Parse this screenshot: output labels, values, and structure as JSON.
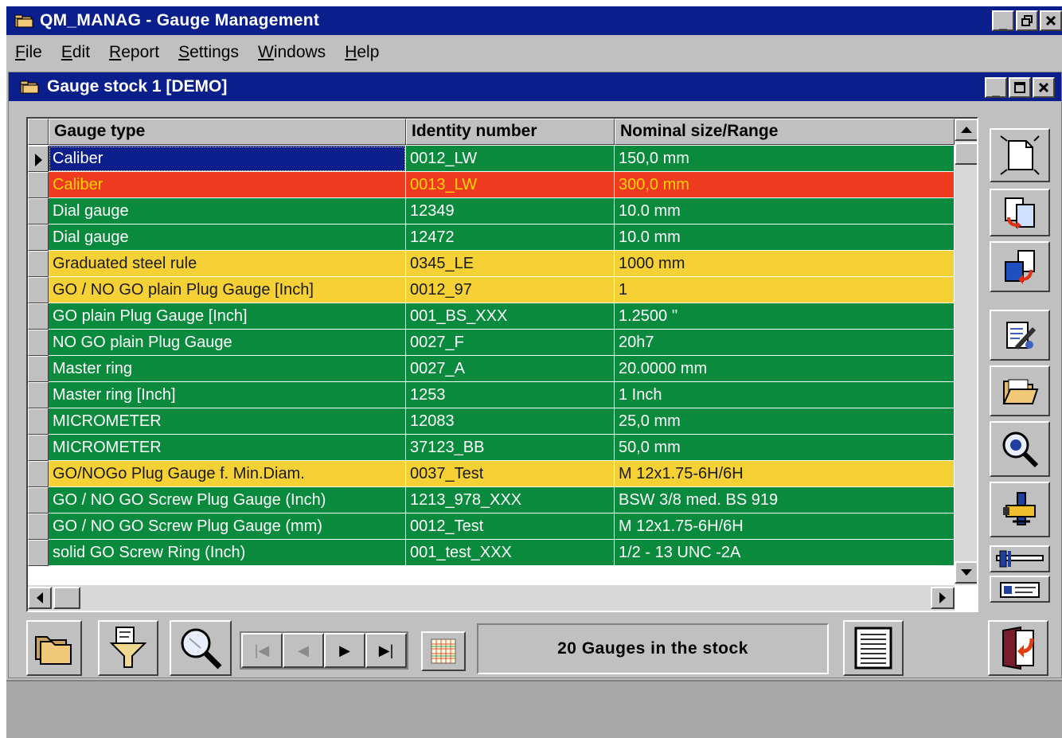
{
  "app": {
    "title": "QM_MANAG - Gauge Management"
  },
  "menu": [
    {
      "label": "File",
      "key": "F",
      "rest": "ile"
    },
    {
      "label": "Edit",
      "key": "E",
      "rest": "dit"
    },
    {
      "label": "Report",
      "key": "R",
      "rest": "eport"
    },
    {
      "label": "Settings",
      "key": "S",
      "rest": "ettings"
    },
    {
      "label": "Windows",
      "key": "W",
      "rest": "indows"
    },
    {
      "label": "Help",
      "key": "H",
      "rest": "elp"
    }
  ],
  "window_buttons": {
    "minimize": "_",
    "restore": "🗗",
    "close": "✕"
  },
  "child_window": {
    "title": "Gauge stock 1 [DEMO]"
  },
  "table": {
    "columns": [
      "Gauge type",
      "Identity number",
      "Nominal size/Range"
    ],
    "rows": [
      {
        "type": "Caliber",
        "id": "0012_LW",
        "size": "150,0 mm",
        "status": "green",
        "selected": true
      },
      {
        "type": "Caliber",
        "id": "0013_LW",
        "size": "300,0 mm",
        "status": "red"
      },
      {
        "type": "Dial gauge",
        "id": "12349",
        "size": "10.0 mm",
        "status": "green"
      },
      {
        "type": "Dial gauge",
        "id": "12472",
        "size": "10.0 mm",
        "status": "green"
      },
      {
        "type": "Graduated steel rule",
        "id": "0345_LE",
        "size": "1000 mm",
        "status": "yellow"
      },
      {
        "type": "GO / NO GO plain Plug Gauge [Inch]",
        "id": "0012_97",
        "size": "1",
        "status": "yellow"
      },
      {
        "type": "GO plain Plug Gauge [Inch]",
        "id": "001_BS_XXX",
        "size": "1.2500 ''",
        "status": "green"
      },
      {
        "type": "NO GO plain Plug Gauge",
        "id": "0027_F",
        "size": "20h7",
        "status": "green"
      },
      {
        "type": "Master ring",
        "id": "0027_A",
        "size": "20.0000 mm",
        "status": "green"
      },
      {
        "type": "Master ring [Inch]",
        "id": "1253",
        "size": "1 Inch",
        "status": "green"
      },
      {
        "type": "MICROMETER",
        "id": "12083",
        "size": "25,0 mm",
        "status": "green"
      },
      {
        "type": "MICROMETER",
        "id": "37123_BB",
        "size": "50,0 mm",
        "status": "green"
      },
      {
        "type": "GO/NOGo Plug Gauge f. Min.Diam.",
        "id": "0037_Test",
        "size": "M 12x1.75-6H/6H",
        "status": "yellow"
      },
      {
        "type": "GO / NO GO Screw Plug Gauge (Inch)",
        "id": "1213_978_XXX",
        "size": " BSW 3/8 med. BS 919",
        "status": "green"
      },
      {
        "type": "GO / NO GO Screw Plug Gauge (mm)",
        "id": "0012_Test",
        "size": "M 12x1.75-6H/6H",
        "status": "green"
      },
      {
        "type": "solid GO Screw Ring (Inch)",
        "id": "001_test_XXX",
        "size": "1/2 - 13 UNC -2A",
        "status": "green"
      }
    ]
  },
  "status": {
    "text": "20  Gauges in the stock"
  },
  "colors": {
    "green": "#098a3c",
    "red": "#ee3a1e",
    "yellow": "#f6d135",
    "titlebar": "#0a1e8c"
  },
  "side_toolbar": [
    "new-document-icon",
    "copy-record-icon",
    "import-record-icon",
    "edit-record-icon",
    "open-folder-icon",
    "search-gauge-icon",
    "calibration-tool-icon",
    "caliper-icon",
    "measure-card-icon"
  ],
  "bottom_toolbar": [
    "stock-folders-icon",
    "filter-icon",
    "search-icon",
    "first-record-icon",
    "prev-record-icon",
    "next-record-icon",
    "last-record-icon",
    "grid-view-icon",
    "print-list-icon",
    "exit-icon"
  ]
}
